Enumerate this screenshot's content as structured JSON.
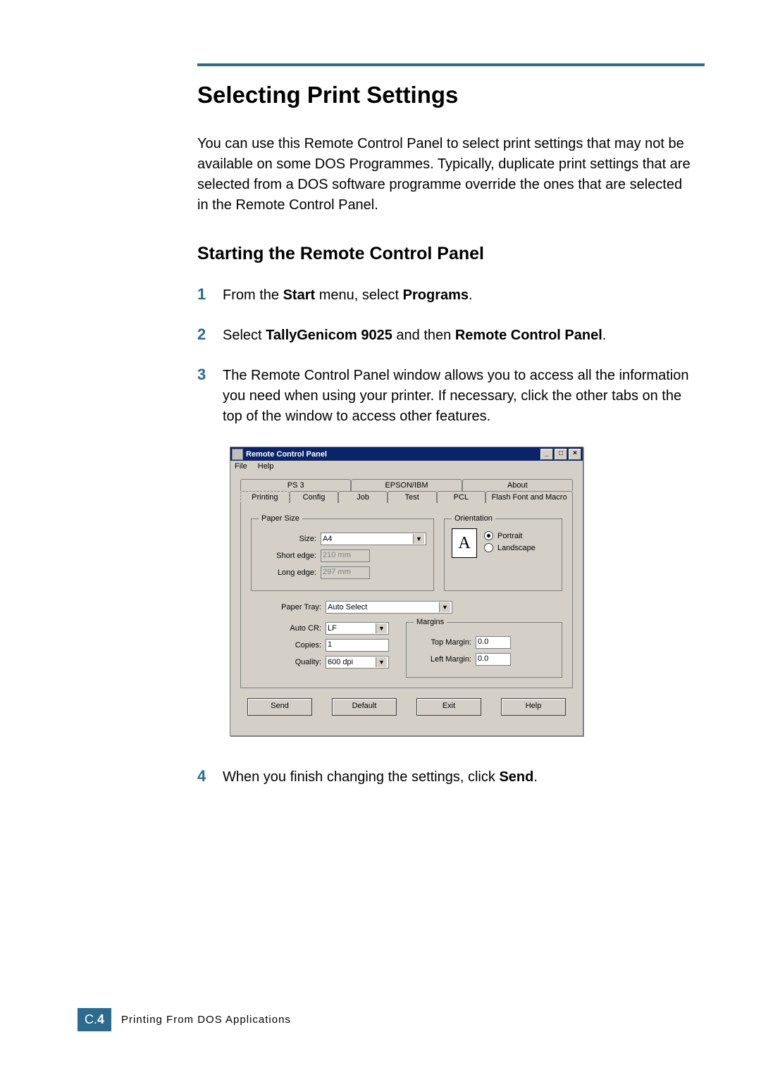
{
  "page": {
    "title": "Selecting Print Settings",
    "intro": "You can use this Remote Control Panel to select print settings that may not be available on some DOS Programmes. Typically, duplicate print settings that are selected from a DOS software programme override the ones that are selected in the Remote Control Panel.",
    "subtitle": "Starting the Remote Control Panel"
  },
  "steps": {
    "s1_num": "1",
    "s1_a": "From the ",
    "s1_b": "Start",
    "s1_c": " menu, select ",
    "s1_d": "Programs",
    "s1_e": ".",
    "s2_num": "2",
    "s2_a": "Select ",
    "s2_b": "TallyGenicom 9025",
    "s2_c": " and then ",
    "s2_d": "Remote Control Panel",
    "s2_e": ".",
    "s3_num": "3",
    "s3_txt": "The Remote Control Panel window allows you to access all the information you need when using your printer. If necessary, click the other tabs on the top of the window to access other features.",
    "s4_num": "4",
    "s4_a": "When you finish changing the settings, click ",
    "s4_b": "Send",
    "s4_c": "."
  },
  "window": {
    "title": "Remote Control Panel",
    "min": "_",
    "max": "□",
    "close": "×",
    "menu_file": "File",
    "menu_help": "Help",
    "tabs_top": {
      "ps3": "PS 3",
      "epson": "EPSON/IBM",
      "about": "About"
    },
    "tabs_bot": {
      "printing": "Printing",
      "config": "Config",
      "job": "Job",
      "test": "Test",
      "pcl": "PCL",
      "flash": "Flash Font and Macro"
    },
    "paper": {
      "legend": "Paper Size",
      "size_label": "Size:",
      "size_value": "A4",
      "short_label": "Short edge:",
      "short_value": "210 mm",
      "long_label": "Long edge:",
      "long_value": "297 mm"
    },
    "orientation": {
      "legend": "Orientation",
      "icon_letter": "A",
      "portrait": "Portrait",
      "landscape": "Landscape"
    },
    "fields": {
      "tray_label": "Paper Tray:",
      "tray_value": "Auto Select",
      "autocr_label": "Auto CR:",
      "autocr_value": "LF",
      "copies_label": "Copies:",
      "copies_value": "1",
      "quality_label": "Quality:",
      "quality_value": "600 dpi"
    },
    "margins": {
      "legend": "Margins",
      "top_label": "Top Margin:",
      "top_value": "0.0",
      "left_label": "Left Margin:",
      "left_value": "0.0"
    },
    "buttons": {
      "send": "Send",
      "default": "Default",
      "exit": "Exit",
      "help": "Help"
    }
  },
  "footer": {
    "tab_prefix": "C.",
    "tab_num": "4",
    "caption": "Printing From DOS Applications"
  }
}
